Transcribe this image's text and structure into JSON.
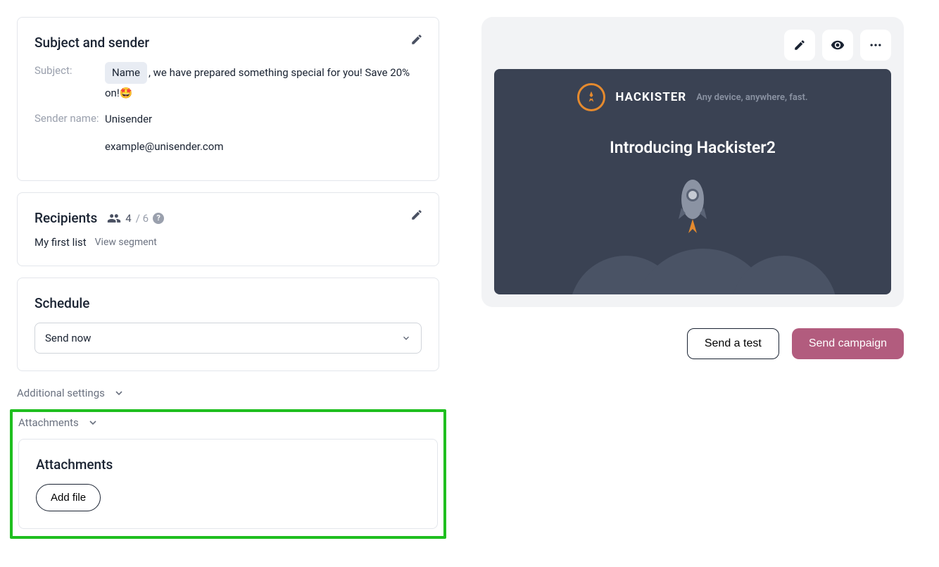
{
  "subjectCard": {
    "title": "Subject and sender",
    "subjectLabel": "Subject:",
    "subjectTag": "Name",
    "subjectRest": ", we have prepared something special for you! Save 20% on!🤩",
    "senderLabel": "Sender name:",
    "senderName": "Unisender",
    "senderEmail": "example@unisender.com"
  },
  "recipients": {
    "title": "Recipients",
    "countSelected": "4",
    "countTotal": "/ 6",
    "listName": "My first list",
    "viewSegment": "View segment"
  },
  "schedule": {
    "title": "Schedule",
    "selected": "Send now"
  },
  "additional": {
    "label": "Additional settings"
  },
  "attachments": {
    "toggleLabel": "Attachments",
    "cardTitle": "Attachments",
    "addFile": "Add file"
  },
  "preview": {
    "brand": "HACKISTER",
    "tagline": "Any device, anywhere, fast.",
    "headline": "Introducing Hackister2"
  },
  "actions": {
    "sendTest": "Send a test",
    "sendCampaign": "Send campaign"
  }
}
